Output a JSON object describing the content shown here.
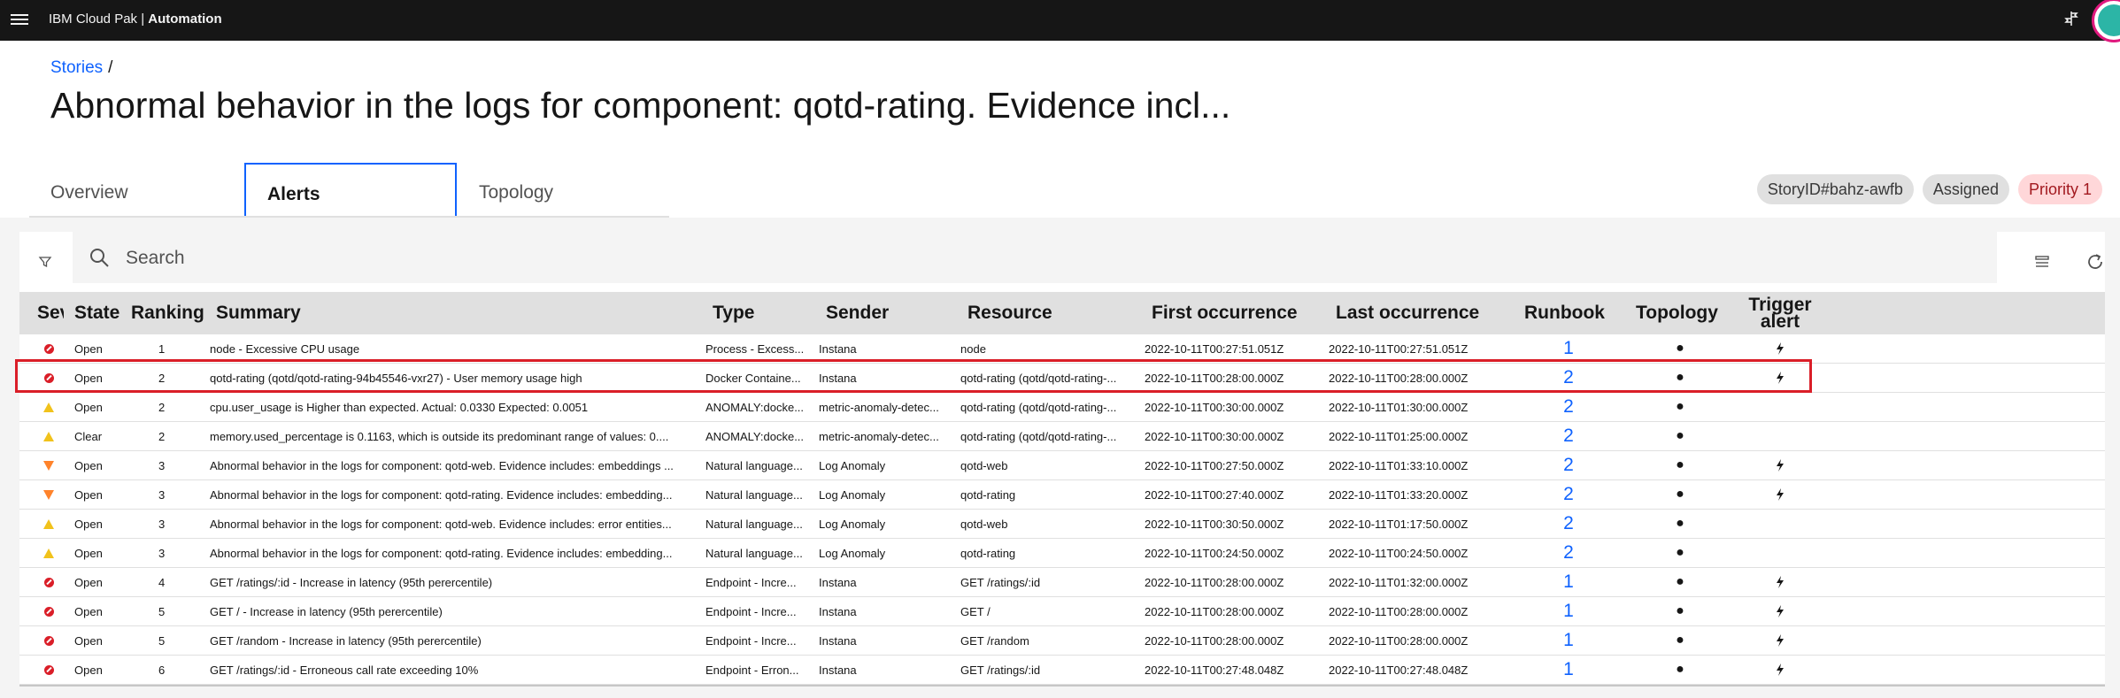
{
  "header": {
    "brand_prefix": "IBM Cloud Pak | ",
    "brand_product": "Automation",
    "icons": [
      "menu-icon",
      "pin-icon",
      "avatar"
    ]
  },
  "breadcrumb": {
    "link": "Stories",
    "separator": "/"
  },
  "page_title": "Abnormal behavior in the logs for component: qotd-rating. Evidence incl...",
  "tabs": [
    {
      "label": "Overview",
      "active": false
    },
    {
      "label": "Alerts",
      "active": true
    },
    {
      "label": "Topology",
      "active": false
    }
  ],
  "tags": {
    "story_id": "StoryID#bahz-awfb",
    "status": "Assigned",
    "priority": "Priority 1"
  },
  "search": {
    "placeholder": "Search"
  },
  "colors": {
    "accent": "#0f62fe",
    "critical": "#da1e28",
    "warning": "#f1c21b",
    "major": "#ff832b",
    "priority_bg": "#ffd7d9"
  },
  "columns": {
    "severity": "Sev",
    "state": "State",
    "ranking": "Ranking",
    "summary": "Summary",
    "type": "Type",
    "sender": "Sender",
    "resource": "Resource",
    "first": "First occurrence",
    "last": "Last occurrence",
    "runbook": "Runbook",
    "topology": "Topology",
    "trigger_line1": "Trigger",
    "trigger_line2": "alert"
  },
  "rows": [
    {
      "severity": "critical",
      "state": "Open",
      "ranking": "1",
      "summary": "node - Excessive CPU usage",
      "type": "Process - Excess...",
      "sender": "Instana",
      "resource": "node",
      "first": "2022-10-11T00:27:51.051Z",
      "last": "2022-10-11T00:27:51.051Z",
      "runbook": "1",
      "topology": "●",
      "trigger": true
    },
    {
      "severity": "critical",
      "state": "Open",
      "ranking": "2",
      "summary": "qotd-rating (qotd/qotd-rating-94b45546-vxr27) - User memory usage high",
      "type": "Docker Containe...",
      "sender": "Instana",
      "resource": "qotd-rating (qotd/qotd-rating-...",
      "first": "2022-10-11T00:28:00.000Z",
      "last": "2022-10-11T00:28:00.000Z",
      "runbook": "2",
      "topology": "●",
      "trigger": true
    },
    {
      "severity": "warning",
      "state": "Open",
      "ranking": "2",
      "summary": "cpu.user_usage is Higher than expected. Actual: 0.0330 Expected: 0.0051",
      "type": "ANOMALY:docke...",
      "sender": "metric-anomaly-detec...",
      "resource": "qotd-rating (qotd/qotd-rating-...",
      "first": "2022-10-11T00:30:00.000Z",
      "last": "2022-10-11T01:30:00.000Z",
      "runbook": "2",
      "topology": "●",
      "trigger": false
    },
    {
      "severity": "warning",
      "state": "Clear",
      "ranking": "2",
      "summary": "memory.used_percentage is 0.1163, which is outside its predominant range of values: 0....",
      "type": "ANOMALY:docke...",
      "sender": "metric-anomaly-detec...",
      "resource": "qotd-rating (qotd/qotd-rating-...",
      "first": "2022-10-11T00:30:00.000Z",
      "last": "2022-10-11T01:25:00.000Z",
      "runbook": "2",
      "topology": "●",
      "trigger": false
    },
    {
      "severity": "major",
      "state": "Open",
      "ranking": "3",
      "summary": "Abnormal behavior in the logs for component: qotd-web. Evidence includes: embeddings ...",
      "type": "Natural language...",
      "sender": "Log Anomaly",
      "resource": "qotd-web",
      "first": "2022-10-11T00:27:50.000Z",
      "last": "2022-10-11T01:33:10.000Z",
      "runbook": "2",
      "topology": "●",
      "trigger": true
    },
    {
      "severity": "major",
      "state": "Open",
      "ranking": "3",
      "summary": "Abnormal behavior in the logs for component: qotd-rating. Evidence includes: embedding...",
      "type": "Natural language...",
      "sender": "Log Anomaly",
      "resource": "qotd-rating",
      "first": "2022-10-11T00:27:40.000Z",
      "last": "2022-10-11T01:33:20.000Z",
      "runbook": "2",
      "topology": "●",
      "trigger": true
    },
    {
      "severity": "warning",
      "state": "Open",
      "ranking": "3",
      "summary": "Abnormal behavior in the logs for component: qotd-web. Evidence includes: error entities...",
      "type": "Natural language...",
      "sender": "Log Anomaly",
      "resource": "qotd-web",
      "first": "2022-10-11T00:30:50.000Z",
      "last": "2022-10-11T01:17:50.000Z",
      "runbook": "2",
      "topology": "●",
      "trigger": false
    },
    {
      "severity": "warning",
      "state": "Open",
      "ranking": "3",
      "summary": "Abnormal behavior in the logs for component: qotd-rating. Evidence includes: embedding...",
      "type": "Natural language...",
      "sender": "Log Anomaly",
      "resource": "qotd-rating",
      "first": "2022-10-11T00:24:50.000Z",
      "last": "2022-10-11T00:24:50.000Z",
      "runbook": "2",
      "topology": "●",
      "trigger": false
    },
    {
      "severity": "critical",
      "state": "Open",
      "ranking": "4",
      "summary": "GET /ratings/:id - Increase in latency (95th perercentile)",
      "type": "Endpoint - Incre...",
      "sender": "Instana",
      "resource": "GET /ratings/:id",
      "first": "2022-10-11T00:28:00.000Z",
      "last": "2022-10-11T01:32:00.000Z",
      "runbook": "1",
      "topology": "●",
      "trigger": true
    },
    {
      "severity": "critical",
      "state": "Open",
      "ranking": "5",
      "summary": "GET / - Increase in latency (95th perercentile)",
      "type": "Endpoint - Incre...",
      "sender": "Instana",
      "resource": "GET /",
      "first": "2022-10-11T00:28:00.000Z",
      "last": "2022-10-11T00:28:00.000Z",
      "runbook": "1",
      "topology": "●",
      "trigger": true
    },
    {
      "severity": "critical",
      "state": "Open",
      "ranking": "5",
      "summary": "GET /random - Increase in latency (95th perercentile)",
      "type": "Endpoint - Incre...",
      "sender": "Instana",
      "resource": "GET /random",
      "first": "2022-10-11T00:28:00.000Z",
      "last": "2022-10-11T00:28:00.000Z",
      "runbook": "1",
      "topology": "●",
      "trigger": true
    },
    {
      "severity": "critical",
      "state": "Open",
      "ranking": "6",
      "summary": "GET /ratings/:id - Erroneous call rate exceeding 10%",
      "type": "Endpoint - Erron...",
      "sender": "Instana",
      "resource": "GET /ratings/:id",
      "first": "2022-10-11T00:27:48.048Z",
      "last": "2022-10-11T00:27:48.048Z",
      "runbook": "1",
      "topology": "●",
      "trigger": true
    }
  ],
  "highlighted_row": 1
}
